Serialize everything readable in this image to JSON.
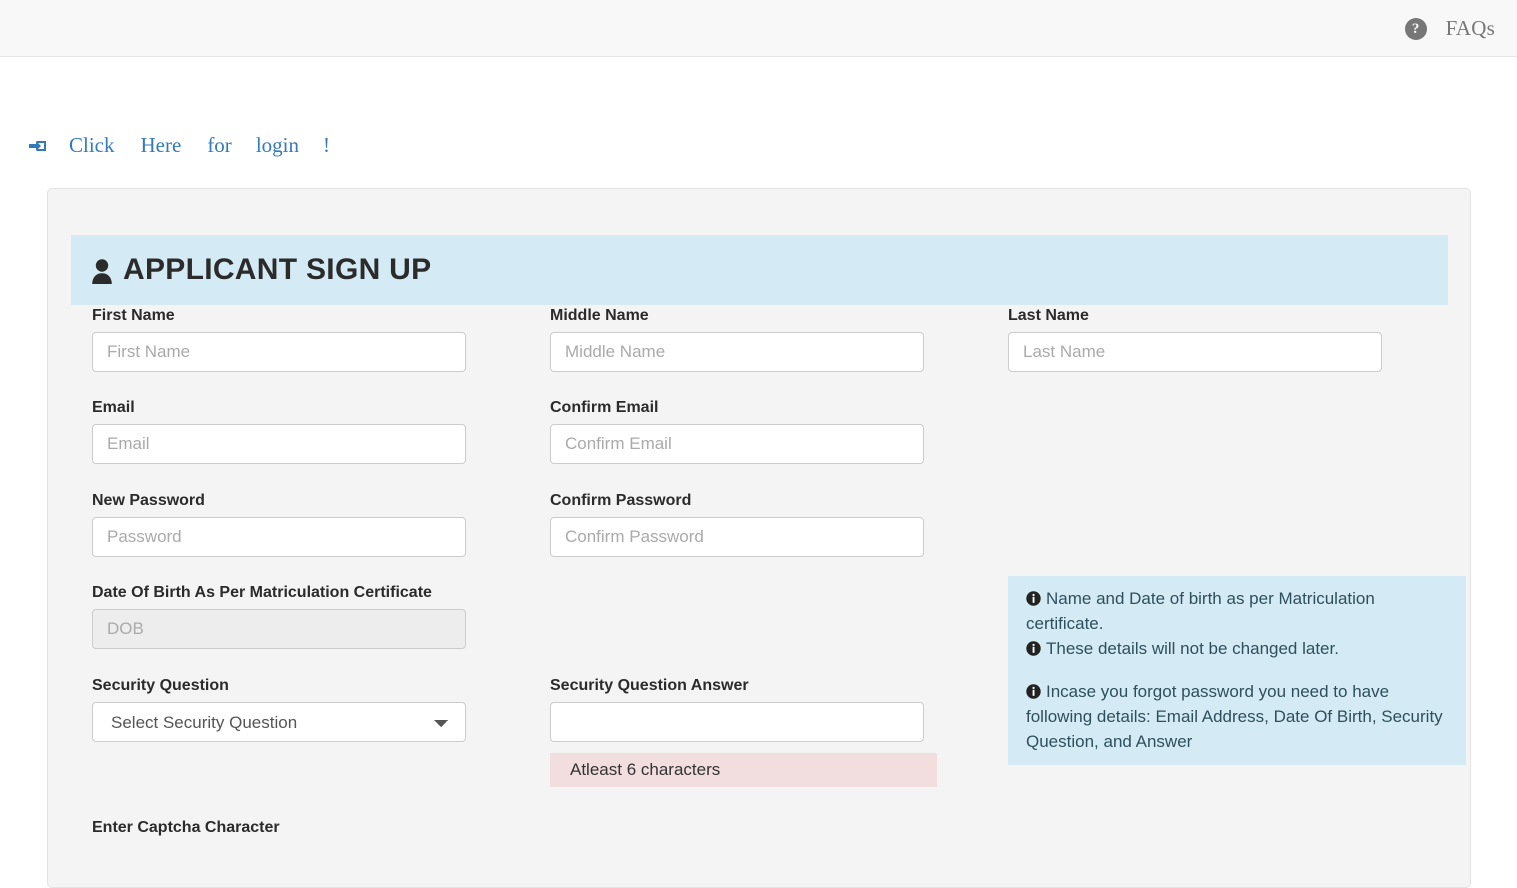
{
  "navbar": {
    "faq_icon": "question-circle-icon",
    "faq_label": "FAQs"
  },
  "login_row": {
    "icon": "sign-in-icon",
    "words": [
      "Click",
      "Here",
      "for",
      "login",
      "!"
    ]
  },
  "panel": {
    "banner": {
      "icon": "user-icon",
      "title": "APPLICANT SIGN UP"
    },
    "fields": {
      "first_name": {
        "label": "First Name",
        "placeholder": "First Name",
        "value": ""
      },
      "middle_name": {
        "label": "Middle Name",
        "placeholder": "Middle Name",
        "value": ""
      },
      "last_name": {
        "label": "Last Name",
        "placeholder": "Last Name",
        "value": ""
      },
      "email": {
        "label": "Email",
        "placeholder": "Email",
        "value": ""
      },
      "confirm_email": {
        "label": "Confirm Email",
        "placeholder": "Confirm Email",
        "value": ""
      },
      "new_password": {
        "label": "New Password",
        "placeholder": "Password",
        "value": ""
      },
      "confirm_password": {
        "label": "Confirm Password",
        "placeholder": "Confirm Password",
        "value": ""
      },
      "dob": {
        "label": "Date Of Birth As Per Matriculation Certificate",
        "placeholder": "DOB",
        "value": "",
        "disabled": true
      },
      "security_question": {
        "label": "Security Question",
        "selected": "Select Security Question"
      },
      "security_answer": {
        "label": "Security Question Answer",
        "placeholder": "",
        "value": ""
      },
      "captcha": {
        "label": "Enter Captcha Character"
      }
    },
    "validation": {
      "security_answer_error": "Atleast 6 characters"
    },
    "alerts": [
      {
        "icon": "info-circle-icon",
        "lines": [
          "Name and Date of birth as per Matriculation certificate.",
          "These details will not be changed later."
        ]
      },
      {
        "icon": "info-circle-icon",
        "lines": [
          "Incase you forgot password you need to have following details: Email Address, Date Of Birth, Security Question, and Answer"
        ]
      }
    ]
  },
  "colors": {
    "banner_bg": "#d4ebf5",
    "panel_bg": "#f4f4f4",
    "link_blue": "#337ab7",
    "error_bg": "#f2dede",
    "navbar_bg": "#f8f8f8"
  }
}
